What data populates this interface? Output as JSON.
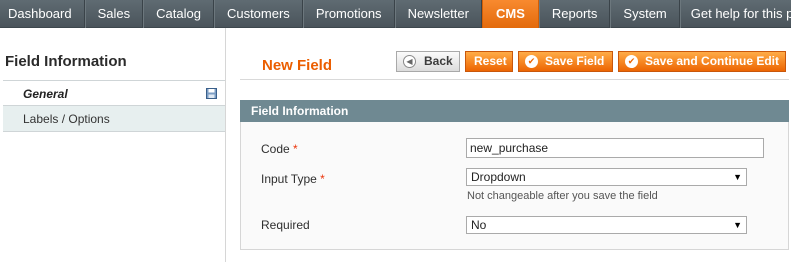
{
  "nav": {
    "items": [
      "Dashboard",
      "Sales",
      "Catalog",
      "Customers",
      "Promotions",
      "Newsletter",
      "CMS",
      "Reports",
      "System"
    ],
    "active": "CMS",
    "help": "Get help for this page"
  },
  "sidebar": {
    "title": "Field Information",
    "tabs": [
      {
        "label": "General",
        "active": true,
        "icon": "save-icon"
      },
      {
        "label": "Labels / Options",
        "active": false
      }
    ]
  },
  "header": {
    "title": "New Field",
    "buttons": {
      "back": "Back",
      "reset": "Reset",
      "save": "Save Field",
      "save_continue": "Save and Continue Edit"
    }
  },
  "fieldset": {
    "title": "Field Information",
    "fields": {
      "code": {
        "label": "Code",
        "required": "*",
        "value": "new_purchase"
      },
      "input_type": {
        "label": "Input Type",
        "required": "*",
        "value": "Dropdown",
        "note": "Not changeable after you save the field"
      },
      "required": {
        "label": "Required",
        "value": "No"
      }
    }
  },
  "colors": {
    "accent": "#eb5e00",
    "nav_bg": "#56616a",
    "fieldset_header": "#6f8992"
  }
}
